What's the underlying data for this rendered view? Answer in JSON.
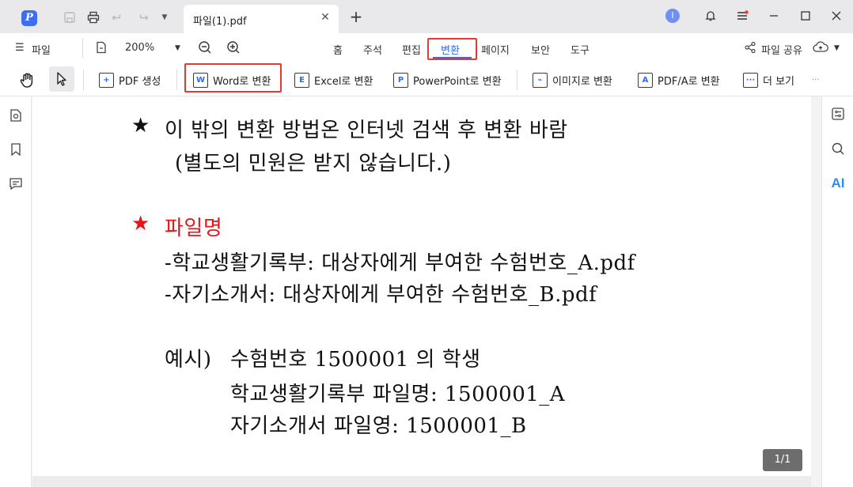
{
  "app": {
    "logo_glyph": "P"
  },
  "tab": {
    "title": "파일(1).pdf",
    "close": "✕",
    "new": "+"
  },
  "account": {
    "initial": "I"
  },
  "menu": {
    "file": "파일",
    "zoom": "200%",
    "items": [
      "홈",
      "주석",
      "편집",
      "변환",
      "페이지",
      "보안",
      "도구"
    ],
    "active": "변환",
    "share": "파일 공유"
  },
  "toolbar": {
    "create_pdf": "PDF 생성",
    "to_word": "Word로 변환",
    "to_excel": "Excel로 변환",
    "to_ppt": "PowerPoint로 변환",
    "to_image": "이미지로 변환",
    "to_pdfa": "PDF/A로 변환",
    "more": "더 보기",
    "overflow": "···"
  },
  "rail": {
    "ai": "AI"
  },
  "document": {
    "star": "★",
    "line1": "이 밖의 변환 방법온 인터넷 검색 후 변환 바람",
    "line2": "(별도의 민원은 받지 않습니다.)",
    "heading": "파일명",
    "line3": "-학교생활기록부: 대상자에게 부여한 수험번호_A.pdf",
    "line4": "-자기소개서: 대상자에게 부여한 수험번호_B.pdf",
    "line5_prefix": "예시)",
    "line5": "수험번호 1500001 의 학생",
    "line6": "학교생활기록부 파일명: 1500001_A",
    "line7": "자기소개서 파일영: 1500001_B"
  },
  "page_indicator": "1/1",
  "colors": {
    "accent": "#2f6bf2",
    "highlight": "#e53935",
    "heading_red": "#e8141b"
  }
}
